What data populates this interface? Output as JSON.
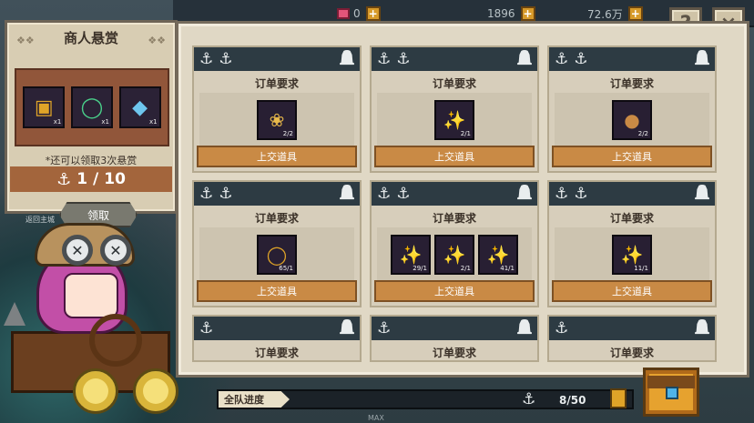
{
  "top_bar": {
    "resources": [
      {
        "value": "0",
        "icon": "gem-icon"
      },
      {
        "value": "1896",
        "icon": "coin-icon"
      },
      {
        "value": "72.6万",
        "icon": "gold-icon"
      }
    ],
    "help_label": "?",
    "close_label": "×"
  },
  "bounty": {
    "title": "商人悬赏",
    "rewards": [
      {
        "icon": "treasure-chest-icon",
        "count": "x1"
      },
      {
        "icon": "green-ring-icon",
        "count": "x1"
      },
      {
        "icon": "blue-gem-icon",
        "count": "x1"
      }
    ],
    "note": "*还可以领取3次悬赏",
    "progress_current": "1",
    "progress_total": "10",
    "claim_label": "领取"
  },
  "home_label": "返回主城",
  "orders": [
    {
      "title": "订单要求",
      "submit_label": "上交道具",
      "items": [
        {
          "icon": "shell-icon",
          "qty": "2/2"
        }
      ]
    },
    {
      "title": "订单要求",
      "submit_label": "上交道具",
      "items": [
        {
          "icon": "fish-icon",
          "qty": "2/1"
        }
      ]
    },
    {
      "title": "订单要求",
      "submit_label": "上交道具",
      "items": [
        {
          "icon": "mushroom-icon",
          "qty": "2/2"
        }
      ]
    },
    {
      "title": "订单要求",
      "submit_label": "上交道具",
      "items": [
        {
          "icon": "jar-icon",
          "qty": "65/1"
        }
      ]
    },
    {
      "title": "订单要求",
      "submit_label": "上交道具",
      "items": [
        {
          "icon": "grey-fish-icon",
          "qty": "29/1"
        },
        {
          "icon": "fish-icon",
          "qty": "2/1"
        },
        {
          "icon": "fish-icon",
          "qty": "41/1"
        }
      ]
    },
    {
      "title": "订单要求",
      "submit_label": "上交道具",
      "items": [
        {
          "icon": "fish-icon",
          "qty": "11/1"
        }
      ]
    },
    {
      "title": "订单要求"
    },
    {
      "title": "订单要求"
    },
    {
      "title": "订单要求"
    }
  ],
  "team_progress": {
    "label": "全队进度",
    "value": "8/50"
  },
  "max_label": "MAX",
  "colors": {
    "header": "#2d3b43",
    "submit": "#c98a45",
    "panel": "#e0d8c5"
  }
}
